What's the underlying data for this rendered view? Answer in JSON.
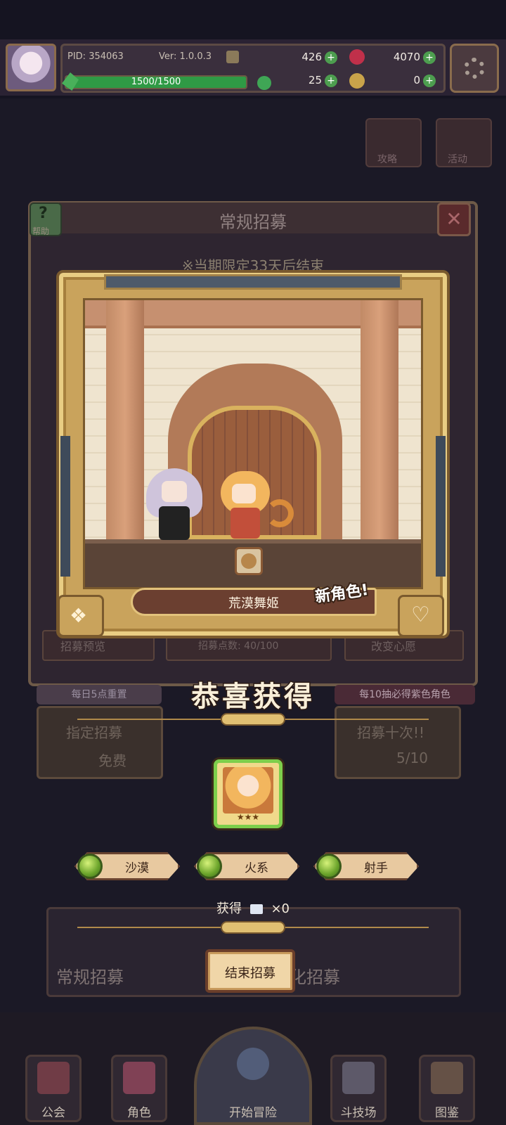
{
  "header": {
    "pid": "PID: 354063",
    "version": "Ver: 1.0.0.3",
    "energy": "1500/1500",
    "energy_fraction": 1.0,
    "currency_a": "426",
    "currency_b": "4070",
    "currency_c": "25",
    "currency_d": "0"
  },
  "recruit": {
    "title": "常规招募",
    "help_label": "帮助",
    "limited_notice": "※当期限定33天后结束"
  },
  "reward": {
    "character_name": "荒漠舞姬",
    "new_badge": "新角色!",
    "congrats": "恭喜获得",
    "stars": "★★★",
    "traits": [
      "沙漠",
      "火系",
      "射手"
    ],
    "obtain_text": "获得",
    "obtain_count": "×0",
    "end_button": "结束招募"
  },
  "background": {
    "daily_reset": "每日5点重置",
    "guarantee": "每10抽必得紫色角色",
    "designated_recruit": "指定招募",
    "free": "免费",
    "recruit_ten": "招募十次!!",
    "ten_count": "5/10",
    "preview": "招募预览",
    "points": "招募点数: 40/100",
    "change_wish": "改变心愿",
    "banner_left": "常规招募",
    "banner_right": "化招募",
    "strategy": "攻略",
    "event": "活动"
  },
  "nav": {
    "items": [
      "公会",
      "角色",
      "开始冒险",
      "斗技场",
      "图鉴"
    ]
  },
  "colors": {
    "accent_gold": "#e0bf72",
    "frame_gold": "#c9a35c",
    "card_border_green": "#7dce4b"
  }
}
